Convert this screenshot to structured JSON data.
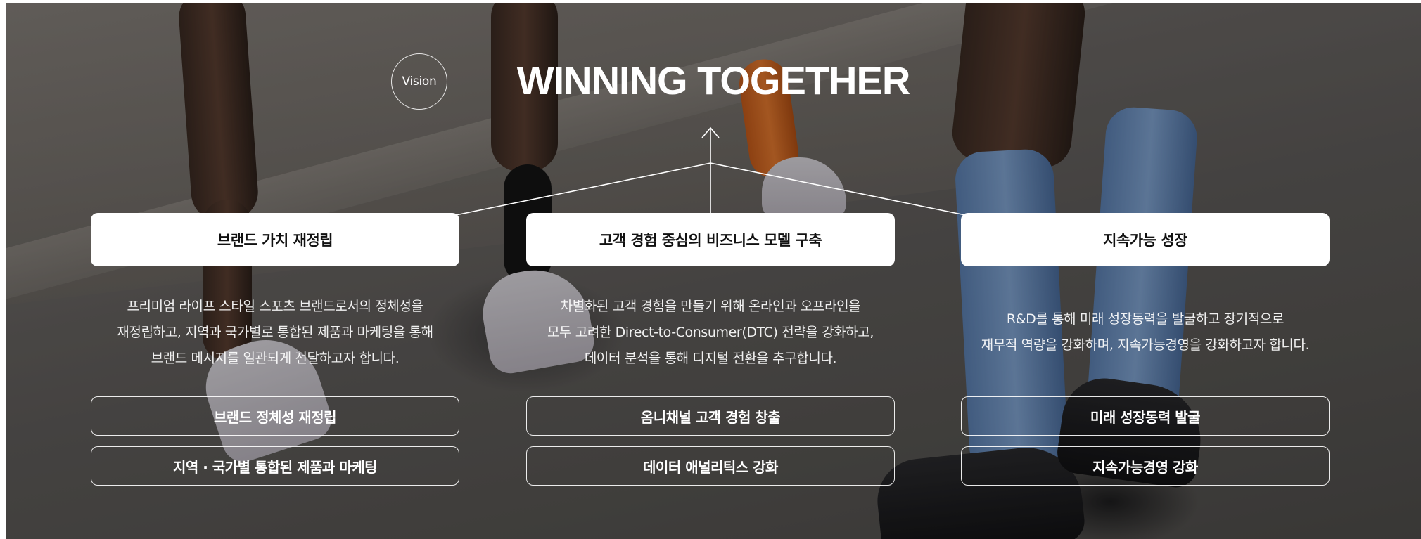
{
  "hero": {
    "vision_label": "Vision",
    "title": "WINNING TOGETHER"
  },
  "pillars": [
    {
      "title": "브랜드 가치 재정립",
      "description": "프리미엄 라이프 스타일 스포츠 브랜드로서의 정체성을\n재정립하고, 지역과 국가별로 통합된 제품과 마케팅을 통해\n브랜드 메시지를 일관되게 전달하고자 합니다.",
      "tags": [
        "브랜드 정체성 재정립",
        "지역 · 국가별 통합된 제품과 마케팅"
      ]
    },
    {
      "title": "고객 경험 중심의 비즈니스 모델 구축",
      "description": "차별화된 고객 경험을 만들기 위해 온라인과 오프라인을\n모두 고려한 Direct-to-Consumer(DTC) 전략을 강화하고,\n데이터 분석을 통해 디지털 전환을 추구합니다.",
      "tags": [
        "옴니채널 고객 경험 창출",
        "데이터 애널리틱스 강화"
      ]
    },
    {
      "title": "지속가능 성장",
      "description": "R&D를 통해 미래 성장동력을 발굴하고 장기적으로\n재무적 역량을 강화하며, 지속가능경영을 강화하고자 합니다.",
      "tags": [
        "미래 성장동력 발굴",
        "지속가능경영 강화"
      ]
    }
  ],
  "colors": {
    "card_bg": "#ffffff",
    "card_text": "#111111",
    "overlay_text": "#ffffff"
  }
}
